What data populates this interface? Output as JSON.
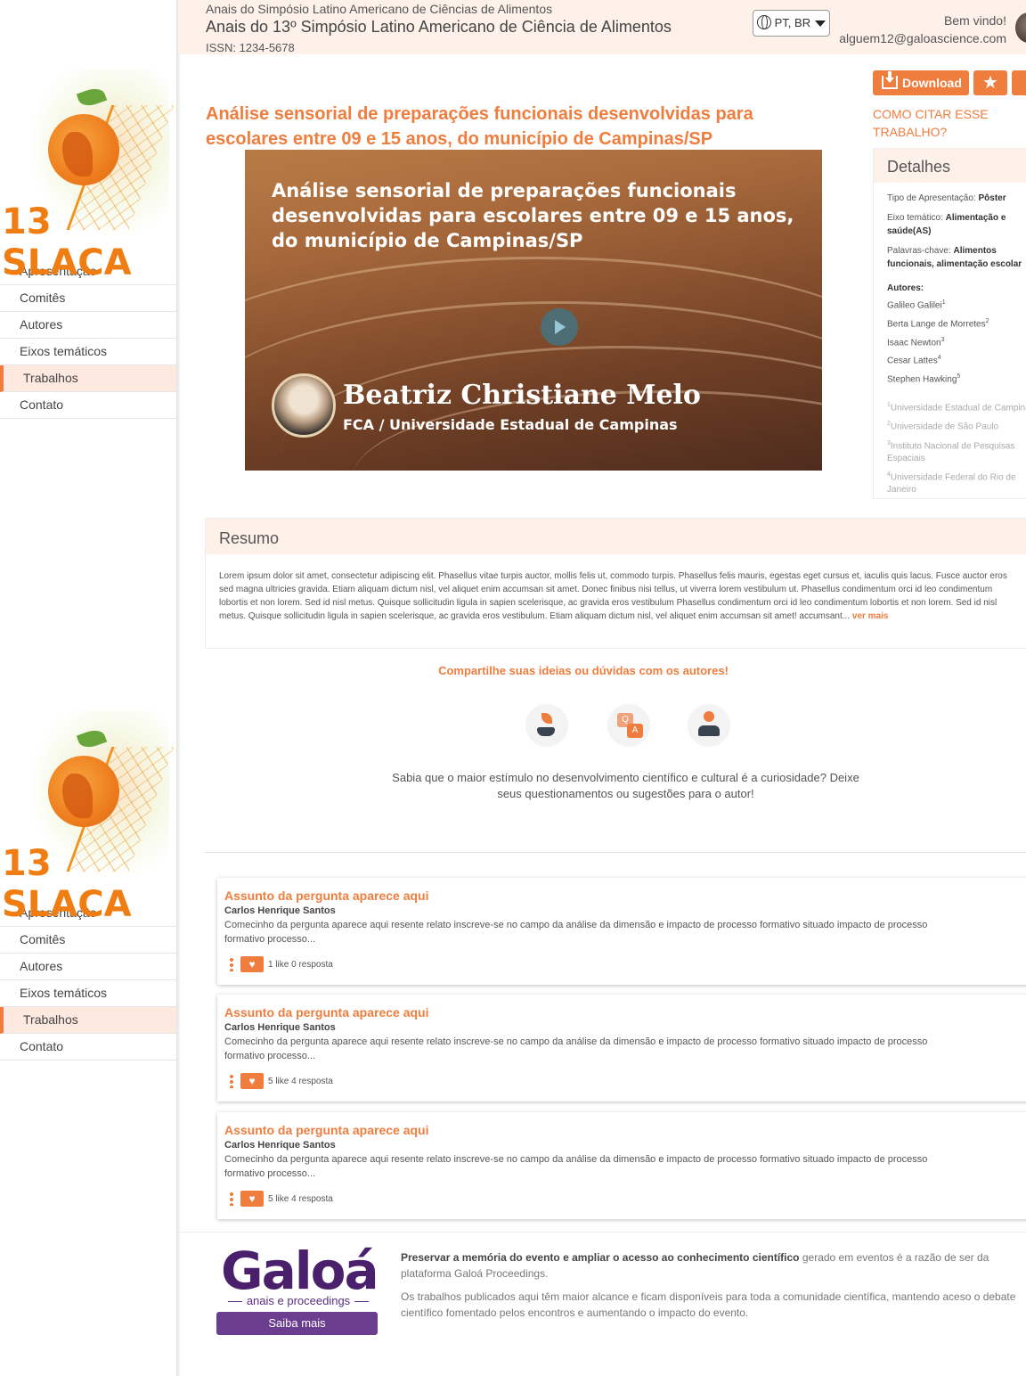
{
  "header": {
    "event_subtitle": "Anais do Simpósio Latino Americano de Ciências de Alimentos",
    "event_title": "Anais do 13º Simpósio Latino Americano de Ciência de Alimentos",
    "issn": "ISSN: 1234-5678",
    "language": "PT, BR",
    "welcome": "Bem vindo!",
    "user_email": "alguem12@galoascience.com"
  },
  "sidebar": {
    "logo_text": "13 SLACA",
    "items": [
      {
        "label": "Apresentação"
      },
      {
        "label": "Comitês"
      },
      {
        "label": "Autores"
      },
      {
        "label": "Eixos temáticos"
      },
      {
        "label": "Trabalhos",
        "active": true
      },
      {
        "label": "Contato"
      }
    ]
  },
  "paper": {
    "title": "Análise sensorial de preparações funcionais desenvolvidas para escolares entre 09 e 15 anos, do município de Campinas/SP"
  },
  "video": {
    "title": "Análise sensorial de preparações funcionais desenvolvidas para escolares entre 09 e 15 anos, do município de Campinas/SP",
    "presenter_name": "Beatriz Christiane Melo",
    "presenter_institution": "FCA / Universidade Estadual de Campinas"
  },
  "actions": {
    "download_label": "Download",
    "cite_label": "COMO CITAR ESSE TRABALHO?"
  },
  "details": {
    "heading": "Detalhes",
    "presentation_type_label": "Tipo de Apresentação:",
    "presentation_type": "Pôster",
    "axis_label": "Eixo temático:",
    "axis": "Alimentação e saúde(AS)",
    "keywords_label": "Palavras-chave:",
    "keywords": "Alimentos funcionais, alimentação escolar",
    "authors_heading": "Autores:",
    "authors": [
      {
        "name": "Galileo Galilei",
        "sup": "1"
      },
      {
        "name": "Berta Lange de Morretes",
        "sup": "2"
      },
      {
        "name": "Isaac Newton",
        "sup": "3"
      },
      {
        "name": "Cesar Lattes",
        "sup": "4"
      },
      {
        "name": "Stephen Hawking",
        "sup": "5"
      }
    ],
    "affiliations": [
      {
        "sup": "1",
        "name": "Universidade Estadual de Campinas"
      },
      {
        "sup": "2",
        "name": "Universidade de São Paulo"
      },
      {
        "sup": "3",
        "name": "Instituto Nacional de Pesquisas Espaciais"
      },
      {
        "sup": "4",
        "name": "Universidade Federal do Rio de Janeiro"
      }
    ]
  },
  "resumo": {
    "heading": "Resumo",
    "text": "Lorem ipsum dolor sit amet, consectetur adipiscing elit. Phasellus vitae turpis auctor, mollis felis ut, commodo turpis. Phasellus felis mauris, egestas eget cursus et, iaculis quis lacus. Fusce auctor eros sed magna ultricies gravida. Etiam aliquam dictum nisl, vel aliquet enim accumsan sit amet. Donec finibus nisi tellus, ut viverra lorem vestibulum ut. Phasellus condimentum orci id leo condimentum lobortis et non lorem. Sed id nisl metus. Quisque sollicitudin ligula in sapien scelerisque, ac gravida eros vestibulum Phasellus condimentum orci id leo condimentum lobortis et non lorem. Sed id nisl metus. Quisque sollicitudin ligula in sapien scelerisque, ac gravida eros vestibulum. Etiam aliquam dictum nisl, vel aliquet enim accumsan sit amet! accumsant...",
    "more_label": "ver mais"
  },
  "share": {
    "title": "Compartilhe suas ideias ou dúvidas com os autores!",
    "icons": [
      "plant-hand-icon",
      "question-answer-icon",
      "people-icon"
    ],
    "text": "Sabia que o maior estímulo no desenvolvimento científico e cultural é a curiosidade? Deixe seus questionamentos ou sugestões para o autor!"
  },
  "questions": [
    {
      "subject": "Assunto da pergunta aparece aqui",
      "author": "Carlos Henrique Santos",
      "text": "Comecinho da pergunta aparece aqui resente relato inscreve-se no campo da análise da dimensão e impacto de processo formativo situado impacto de processo formativo processo...",
      "meta": "1 like 0 resposta"
    },
    {
      "subject": "Assunto da pergunta aparece aqui",
      "author": "Carlos Henrique Santos",
      "text": "Comecinho da pergunta aparece aqui resente relato inscreve-se no campo da análise da dimensão e impacto de processo formativo situado impacto de processo formativo processo...",
      "meta": "5 like 4 resposta"
    },
    {
      "subject": "Assunto da pergunta aparece aqui",
      "author": "Carlos Henrique Santos",
      "text": "Comecinho da pergunta aparece aqui resente relato inscreve-se no campo da análise da dimensão e impacto de processo formativo situado impacto de processo formativo processo...",
      "meta": "5 like 4 resposta"
    }
  ],
  "footer": {
    "logo": "Galoá",
    "logo_sub": "anais e proceedings",
    "button": "Saiba mais",
    "p1_bold": "Preservar a memória do evento e ampliar o acesso ao conhecimento científico",
    "p1_rest": " gerado em eventos é a razão de ser da plataforma Galoá Proceedings.",
    "p2": "Os trabalhos publicados aqui têm maior alcance e ficam disponíveis para toda a comunidade científica, mantendo aceso o debate científico fomentado pelos encontros e aumentando o impacto do evento."
  },
  "colors": {
    "accent": "#ef7d3e",
    "header_bg": "#fdf1ea",
    "galoa_purple": "#4a1f6b"
  }
}
